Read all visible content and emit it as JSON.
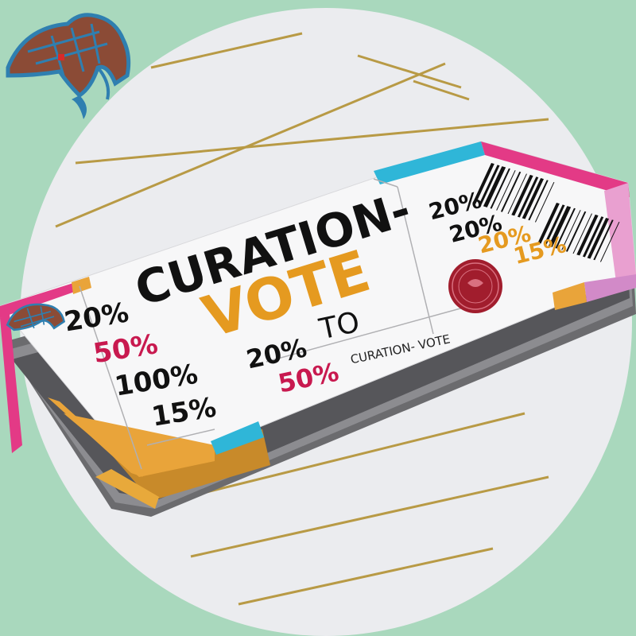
{
  "ticket": {
    "title_line1": "CURATION-",
    "title_line2": "VOTE",
    "left_stub": {
      "rates": [
        {
          "text": "20%",
          "color": "#111111"
        },
        {
          "text": "50%",
          "color": "#c8194f"
        },
        {
          "text": "100%",
          "color": "#111111"
        },
        {
          "text": "15%",
          "color": "#111111"
        }
      ]
    },
    "center": {
      "range_from": "20%",
      "range_word": "TO",
      "range_to": "50%",
      "caption": "CURATION- VOTE"
    },
    "right_stub": {
      "rates": [
        {
          "text": "20%",
          "color": "#111111"
        },
        {
          "text": "20%",
          "color": "#111111"
        },
        {
          "text": "20%",
          "color": "#e59a20"
        },
        {
          "text": "15%",
          "color": "#e59a20"
        }
      ]
    }
  },
  "colors": {
    "background": "#a9d8bd",
    "circle": "#ebecef",
    "pink": "#e33a86",
    "orange": "#e9a43a",
    "cyan": "#2fb6d8",
    "gold": "#e59a20",
    "magenta": "#c8194f",
    "logo_brown": "#8b4b36",
    "logo_blue": "#2f7fb0"
  },
  "icons": [
    "horse-logo-icon",
    "wax-seal-icon",
    "barcode-icon"
  ]
}
